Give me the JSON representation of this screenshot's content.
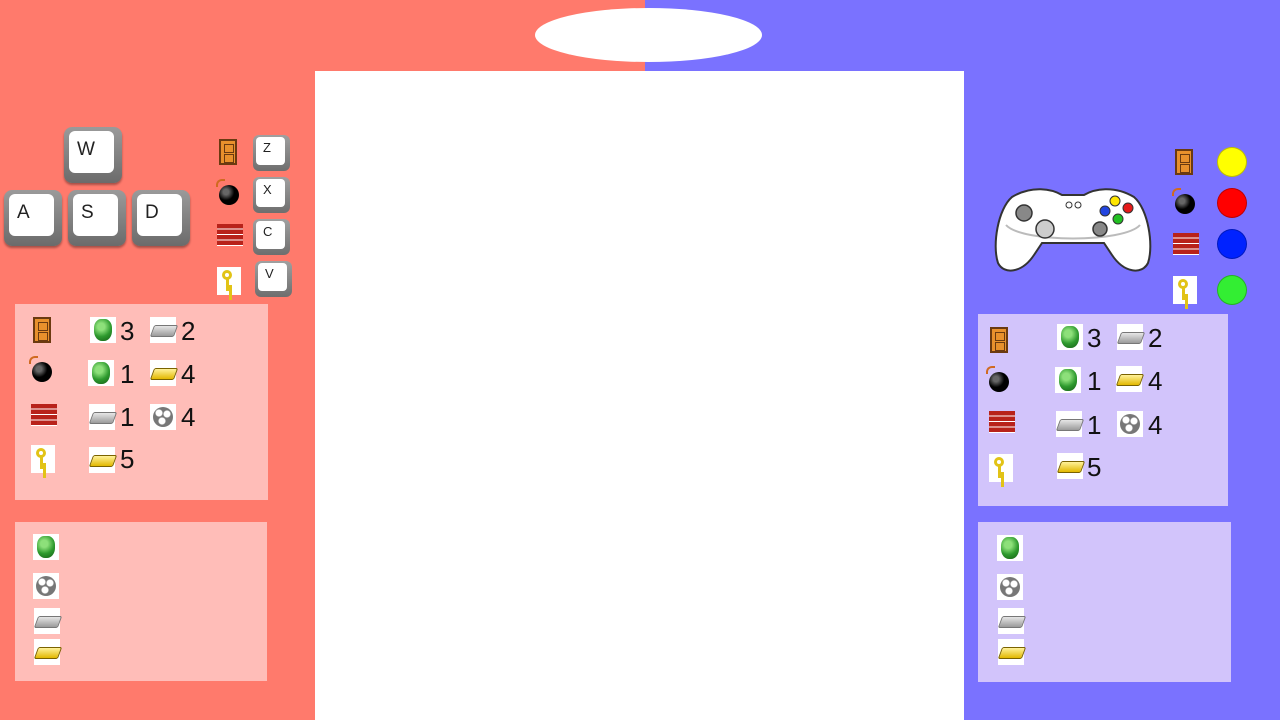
{
  "keyboard": {
    "move_keys": [
      "W",
      "A",
      "S",
      "D"
    ],
    "action_keys": [
      "Z",
      "X",
      "C",
      "V"
    ]
  },
  "actions": [
    {
      "name": "door",
      "icon": "door-icon"
    },
    {
      "name": "bomb",
      "icon": "bomb-icon"
    },
    {
      "name": "wall",
      "icon": "brick-wall-icon"
    },
    {
      "name": "key",
      "icon": "key-icon"
    }
  ],
  "controller": {
    "icon": "gamepad-icon",
    "buttons": [
      {
        "color": "#ffff00"
      },
      {
        "color": "#ff0000"
      },
      {
        "color": "#0022ff"
      },
      {
        "color": "#33ee33"
      }
    ]
  },
  "recipes": {
    "door": [
      {
        "item": "emerald",
        "qty": "3"
      },
      {
        "item": "iron",
        "qty": "2"
      }
    ],
    "bomb": [
      {
        "item": "emerald",
        "qty": "1"
      },
      {
        "item": "gold",
        "qty": "4"
      }
    ],
    "wall": [
      {
        "item": "iron",
        "qty": "1"
      },
      {
        "item": "stone",
        "qty": "4"
      }
    ],
    "key": [
      {
        "item": "gold",
        "qty": "5"
      }
    ]
  },
  "inventory": [
    "emerald",
    "stone",
    "iron",
    "gold"
  ],
  "colors": {
    "player1_bg": "#ff7a6c",
    "player1_panel": "#ffbdb8",
    "player2_bg": "#7a72ff",
    "player2_panel": "#d2c4fb"
  }
}
